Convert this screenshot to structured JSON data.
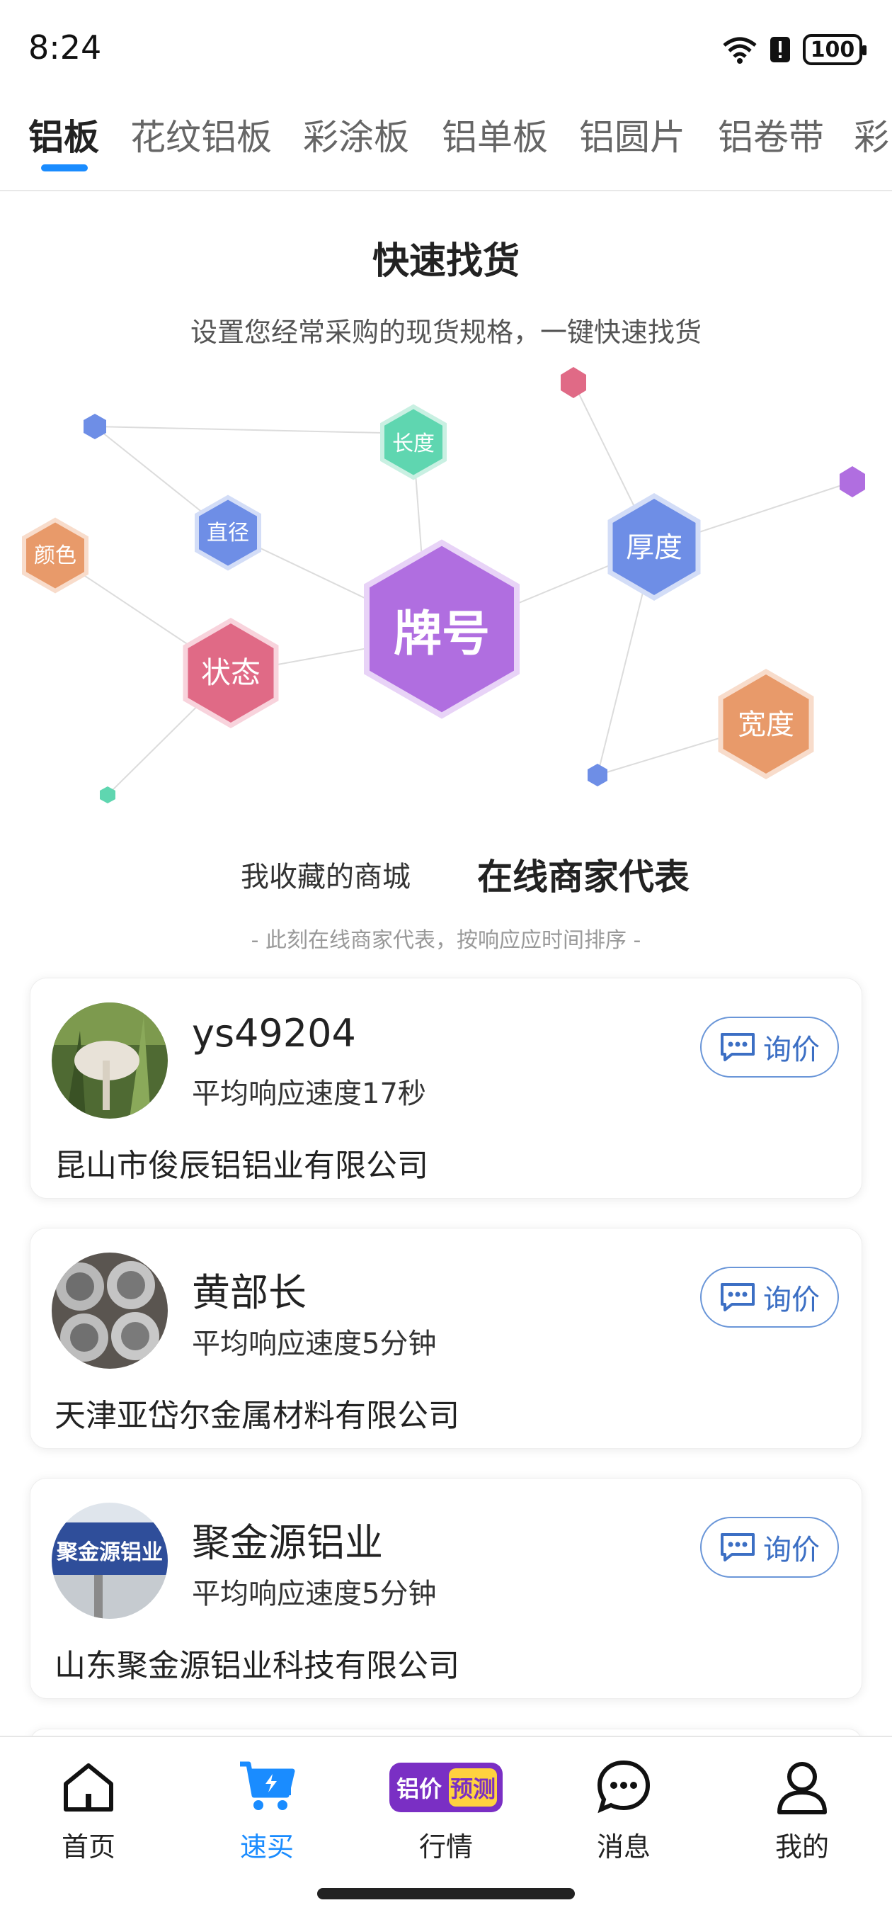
{
  "status_bar": {
    "time": "8:24",
    "battery": "100"
  },
  "tabs": [
    {
      "label": "铝板",
      "active": true
    },
    {
      "label": "花纹铝板"
    },
    {
      "label": "彩涂板"
    },
    {
      "label": "铝单板"
    },
    {
      "label": "铝圆片"
    },
    {
      "label": "铝卷带"
    },
    {
      "label": "彩"
    }
  ],
  "hero": {
    "title": "快速找货",
    "subtitle": "设置您经常采购的现货规格，一键快速找货",
    "nodes": {
      "brand": "牌号",
      "state": "状态",
      "thickness": "厚度",
      "width": "宽度",
      "length": "长度",
      "diameter": "直径",
      "color": "颜色"
    }
  },
  "section": {
    "tab_favorites": "我收藏的商城",
    "tab_online": "在线商家代表",
    "note": "- 此刻在线商家代表，按响应应时间排序 -"
  },
  "merchants": [
    {
      "name": "ys49204",
      "speed": "平均响应速度17秒",
      "company": "昆山市俊辰铝铝业有限公司",
      "ask": "询价"
    },
    {
      "name": "黄部长",
      "speed": "平均响应速度5分钟",
      "company": "天津亚岱尔金属材料有限公司",
      "ask": "询价"
    },
    {
      "name": "聚金源铝业",
      "speed": "平均响应速度5分钟",
      "company": "山东聚金源铝业科技有限公司",
      "ask": "询价",
      "avatar_sign": "聚金源铝业"
    }
  ],
  "bottom_nav": [
    {
      "label": "首页",
      "icon": "home-icon"
    },
    {
      "label": "速买",
      "icon": "cart-icon",
      "active": true
    },
    {
      "label": "行情",
      "icon": "price-forecast-badge",
      "badge_left": "铝价",
      "badge_right": "预测"
    },
    {
      "label": "消息",
      "icon": "message-icon"
    },
    {
      "label": "我的",
      "icon": "profile-icon"
    }
  ],
  "colors": {
    "accent": "#1a8cff",
    "purple": "#b06ee0",
    "red": "#e06a86",
    "blue": "#6e8ee6",
    "green": "#5fd6b0",
    "orange": "#e89a6a"
  }
}
